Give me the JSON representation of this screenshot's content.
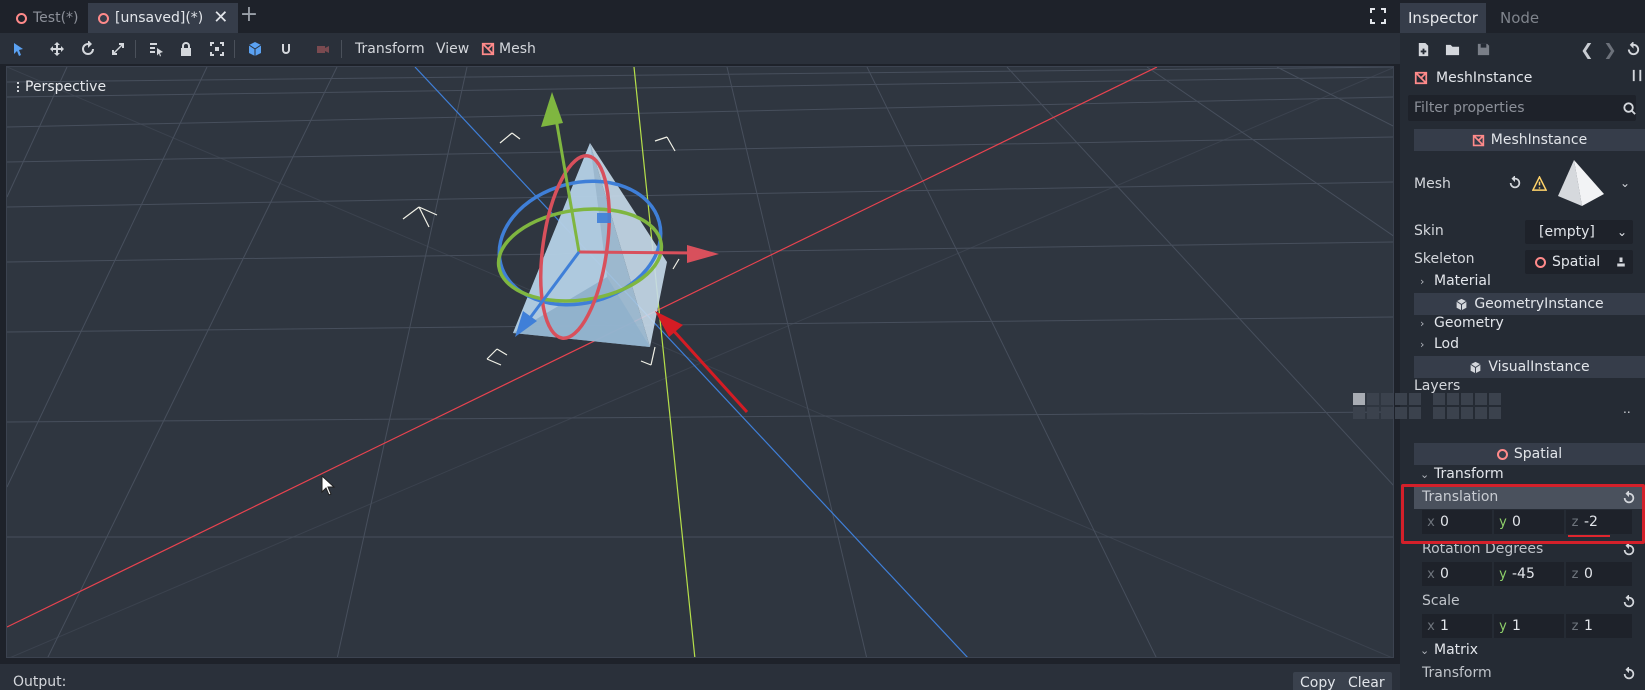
{
  "scene_tabs": [
    {
      "label": "Test(*)",
      "active": false
    },
    {
      "label": "[unsaved](*)",
      "active": true
    }
  ],
  "toolbar": {
    "menus": [
      "Transform",
      "View",
      "Mesh"
    ]
  },
  "viewport": {
    "mode_label": "Perspective"
  },
  "output": {
    "label": "Output:",
    "copy_label": "Copy",
    "clear_label": "Clear"
  },
  "inspector": {
    "tabs": [
      {
        "label": "Inspector",
        "active": true
      },
      {
        "label": "Node",
        "active": false
      }
    ],
    "node_name": "MeshInstance",
    "filter_placeholder": "Filter properties",
    "sections": {
      "mesh_instance": "MeshInstance",
      "geometry_instance": "GeometryInstance",
      "visual_instance": "VisualInstance",
      "spatial": "Spatial"
    },
    "props": {
      "mesh": "Mesh",
      "skin": "Skin",
      "skin_value": "[empty]",
      "skeleton": "Skeleton",
      "skeleton_value": "Spatial",
      "layers": "Layers",
      "layers_more": ".."
    },
    "categories": {
      "material": "Material",
      "geometry": "Geometry",
      "lod": "Lod",
      "transform": "Transform",
      "matrix": "Matrix"
    },
    "transform": {
      "translation": {
        "label": "Translation",
        "x": "0",
        "y": "0",
        "z": "-2"
      },
      "rotation": {
        "label": "Rotation Degrees",
        "x": "0",
        "y": "-45",
        "z": "0"
      },
      "scale": {
        "label": "Scale",
        "x": "1",
        "y": "1",
        "z": "1"
      },
      "matrix_transform_label": "Transform"
    },
    "axis_letters": {
      "x": "x",
      "y": "y",
      "z": "z"
    }
  },
  "colors": {
    "accent_blue": "#5aa1f2",
    "axis_red": "#e8434f",
    "axis_green": "#8cc43f",
    "highlight_red": "#d4202a"
  }
}
